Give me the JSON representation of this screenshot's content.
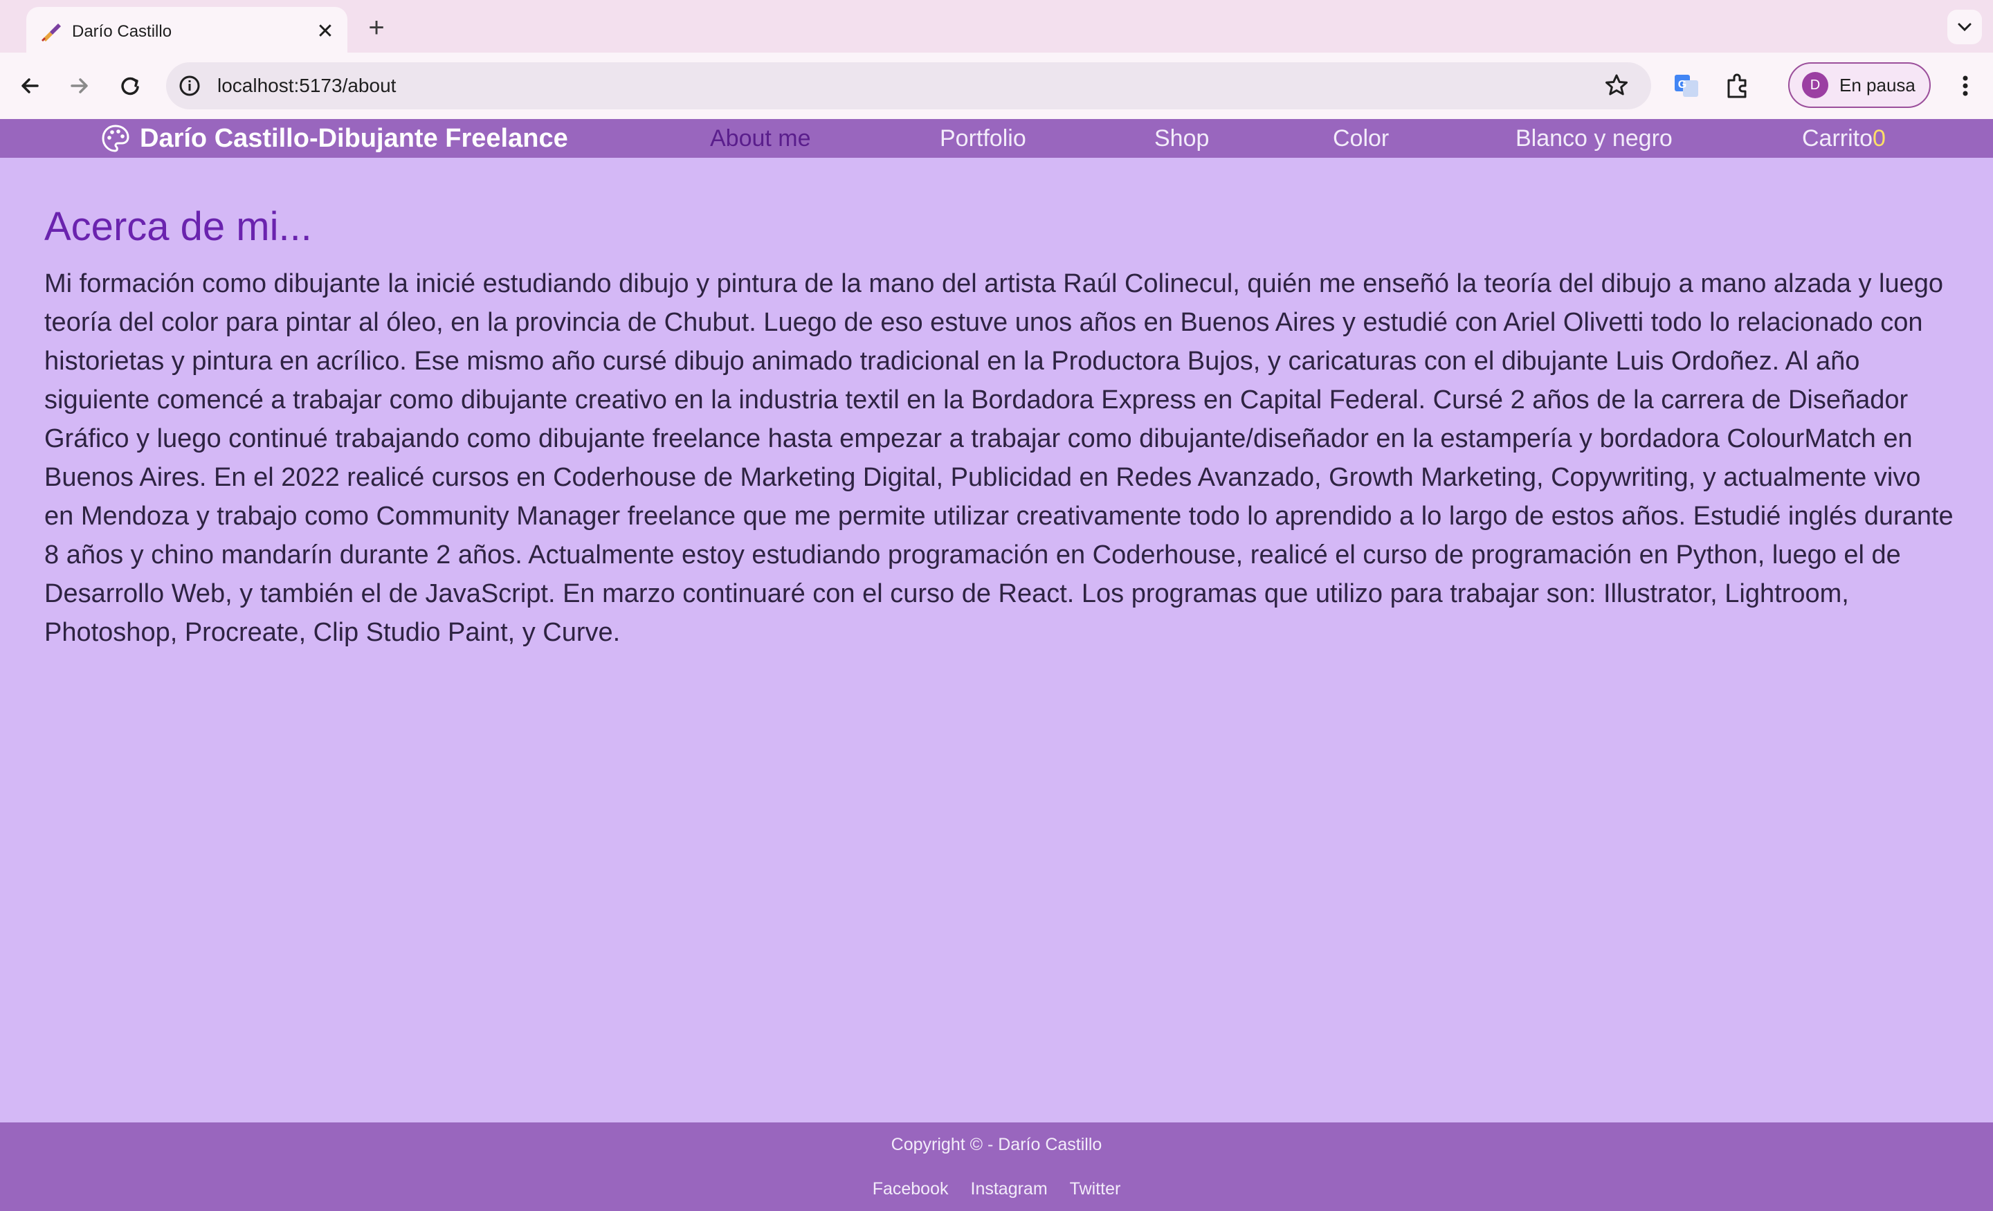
{
  "browser": {
    "tab": {
      "title": "Darío Castillo",
      "favicon": "paintbrush-favicon-icon"
    },
    "url": "localhost:5173/about",
    "profile": {
      "initial": "D",
      "label": "En pausa"
    }
  },
  "site": {
    "brand": "Darío Castillo-Dibujante Freelance",
    "brand_icon": "palette-icon",
    "nav": {
      "about": "About me",
      "portfolio": "Portfolio",
      "shop": "Shop",
      "color": "Color",
      "bw": "Blanco y negro",
      "cart": "Carrito",
      "cart_count": "0"
    },
    "colors": {
      "navbar": "#9966be",
      "page_bg": "#d4b8f6",
      "heading": "#6a23ae",
      "active_link": "#5a1e8c",
      "cart_count": "#ffe066"
    }
  },
  "main": {
    "heading": "Acerca de mi...",
    "body": "Mi formación como dibujante la inicié estudiando dibujo y pintura de la mano del artista Raúl Colinecul, quién me enseñó la teoría del dibujo a mano alzada y luego teoría del color para pintar al óleo, en la provincia de Chubut. Luego de eso estuve unos años en Buenos Aires y estudié con Ariel Olivetti todo lo relacionado con historietas y pintura en acrílico. Ese mismo año cursé dibujo animado tradicional en la Productora Bujos, y caricaturas con el dibujante Luis Ordoñez. Al año siguiente comencé a trabajar como dibujante creativo en la industria textil en la Bordadora Express en Capital Federal. Cursé 2 años de la carrera de Diseñador Gráfico y luego continué trabajando como dibujante freelance hasta empezar a trabajar como dibujante/diseñador en la estampería y bordadora ColourMatch en Buenos Aires. En el 2022 realicé cursos en Coderhouse de Marketing Digital, Publicidad en Redes Avanzado, Growth Marketing, Copywriting, y actualmente vivo en Mendoza y trabajo como Community Manager freelance que me permite utilizar creativamente todo lo aprendido a lo largo de estos años. Estudié inglés durante 8 años y chino mandarín durante 2 años. Actualmente estoy estudiando programación en Coderhouse, realicé el curso de programación en Python, luego el de Desarrollo Web, y también el de JavaScript. En marzo continuaré con el curso de React. Los programas que utilizo para trabajar son: Illustrator, Lightroom, Photoshop, Procreate, Clip Studio Paint, y Curve."
  },
  "footer": {
    "copyright": "Copyright © - Darío Castillo",
    "links": {
      "facebook": "Facebook",
      "instagram": "Instagram",
      "twitter": "Twitter"
    }
  }
}
